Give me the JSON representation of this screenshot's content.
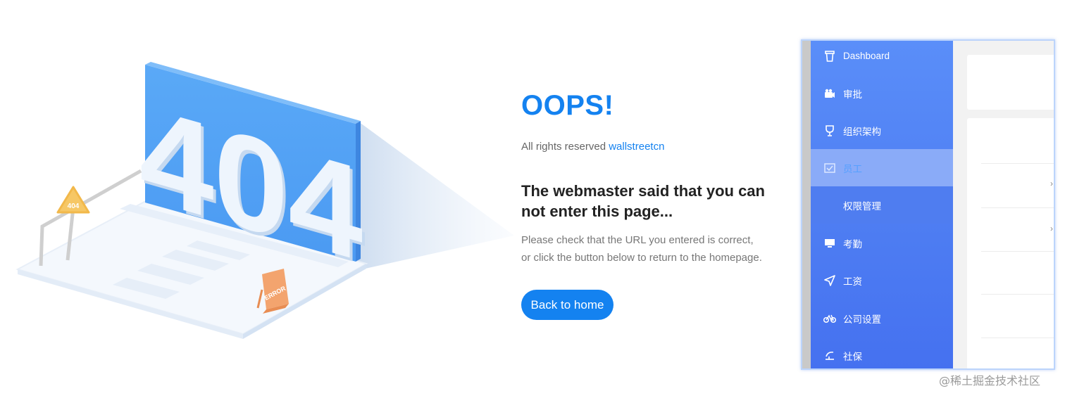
{
  "illustration": {
    "big_number": "404",
    "triangle_sign": "404",
    "error_sign": "ERROR"
  },
  "message": {
    "title": "OOPS!",
    "rights_prefix": "All rights reserved",
    "rights_link": "wallstreetcn",
    "headline": "The webmaster said that you can not enter this page...",
    "info_line1": "Please check that the URL you entered is correct,",
    "info_line2": "or click the button below to return to the homepage.",
    "button_label": "Back to home"
  },
  "app": {
    "sidebar": {
      "items": [
        {
          "label": "Dashboard",
          "icon": "cup-icon"
        },
        {
          "label": "审批",
          "icon": "camera-icon"
        },
        {
          "label": "组织架构",
          "icon": "trophy-icon"
        },
        {
          "label": "员工",
          "icon": "checkbox-icon",
          "active": true
        },
        {
          "label": "权限管理",
          "sub": true
        },
        {
          "label": "考勤",
          "icon": "monitor-icon"
        },
        {
          "label": "工资",
          "icon": "send-icon"
        },
        {
          "label": "公司设置",
          "icon": "bicycle-icon"
        },
        {
          "label": "社保",
          "icon": "umbrella-icon"
        }
      ],
      "active_color": "#56a0ff"
    }
  },
  "watermark": "@稀土掘金技术社区",
  "colors": {
    "accent": "#1482f0",
    "sidebar": "#4f7ff3"
  }
}
